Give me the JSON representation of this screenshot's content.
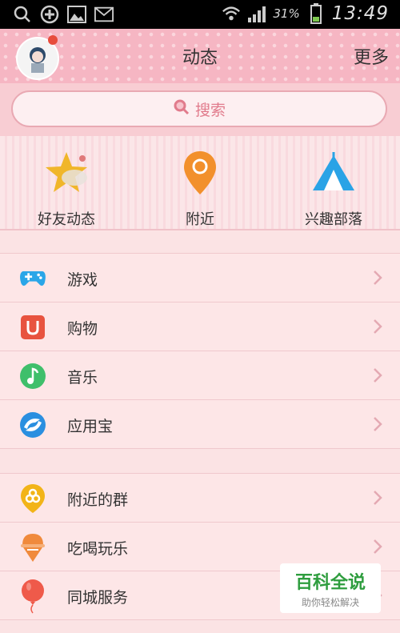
{
  "status_bar": {
    "battery_percent": "31%",
    "time": "13:49"
  },
  "header": {
    "title": "动态",
    "more_label": "更多"
  },
  "search": {
    "placeholder": "搜索"
  },
  "quick_actions": [
    {
      "label": "好友动态",
      "icon": "star-icon"
    },
    {
      "label": "附近",
      "icon": "location-pin-icon"
    },
    {
      "label": "兴趣部落",
      "icon": "tent-icon"
    }
  ],
  "list_group_1": [
    {
      "label": "游戏",
      "icon": "gamepad-icon",
      "color": "#2aa6e8"
    },
    {
      "label": "购物",
      "icon": "shopping-bag-icon",
      "color": "#e8533f"
    },
    {
      "label": "音乐",
      "icon": "music-note-icon",
      "color": "#3fbf6b"
    },
    {
      "label": "应用宝",
      "icon": "app-store-icon",
      "color": "#2a8fe0"
    }
  ],
  "list_group_2": [
    {
      "label": "附近的群",
      "icon": "nearby-group-icon",
      "color": "#f2b418"
    },
    {
      "label": "吃喝玩乐",
      "icon": "ice-cream-icon",
      "color": "#f08a3c"
    },
    {
      "label": "同城服务",
      "icon": "balloon-icon",
      "color": "#ef5a4a"
    }
  ],
  "watermark": {
    "title": "百科全说",
    "subtitle": "助你轻松解决"
  },
  "colors": {
    "header_bg": "#f6b6c3",
    "list_bg": "#fde6e7",
    "accent_pink": "#e17b8c"
  }
}
